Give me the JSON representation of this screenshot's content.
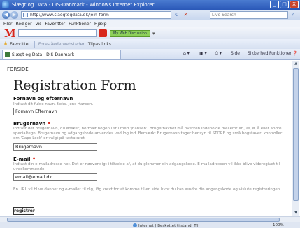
{
  "window": {
    "title": "Slægt og Data - DIS-Danmark - Windows Internet Explorer",
    "minimize": "_",
    "maximize": "□",
    "close": "X"
  },
  "address_bar": {
    "back": "◀",
    "forward": "▶",
    "url": "http://www.slaegtogdata.dk/join_form",
    "refresh": "↻",
    "stop": "✕",
    "search_placeholder": "Live Search",
    "search_go": "⌕"
  },
  "menu": [
    "Filer",
    "Rediger",
    "Vis",
    "Favoritter",
    "Funktioner",
    "Hjælp"
  ],
  "toolbar2": {
    "brand": "M",
    "green_button": "My Web Discussion",
    "chevron": "▾"
  },
  "favorites_bar": {
    "label": "Favoritter",
    "suggested_sites": "Foreslåede websteder",
    "tips": "Tilpas links"
  },
  "tab": {
    "label": "Slægt og Data - DIS-Danmark"
  },
  "command_bar": {
    "side": "Side",
    "security": "Sikkerhed",
    "tools": "Funktioner",
    "help": "❓"
  },
  "page": {
    "breadcrumb": "FORSIDE",
    "heading": "Registration Form",
    "fields": [
      {
        "label": "Fornavn og efternavn",
        "required": false,
        "help": "Indtast dit fulde navn, f.eks. Jens Hansen.",
        "value": "Fornavn Efternavn"
      },
      {
        "label": "Brugernavn",
        "required": true,
        "help": "Indtast det brugernavn, du ønsker, normalt nogen i stil med 'jhansen'. Brugernavnet må hverken indeholde mellemrum, æ, ø, å eller andre specialtegn. Brugernavn og adgangskode anvendes ved log ind. Bemærk: Brugernavn tager hensyn til STORE og små bogstaver, kontroller om 'Caps Lock' er valgt på tastaturet.",
        "value": "Brugernavn"
      },
      {
        "label": "E-mail",
        "required": true,
        "help": "Indtast din e-mailadresse her. Det er nødvendigt i tilfælde af, at du glemmer din adgangskode. E-mailadressen vil ikke blive videregivet til uvedkommende.",
        "value": "email@email.dk"
      }
    ],
    "footer_note": "En URL vil blive dannet og e-mailet til dig, ifig krevt for at komme til en side hvor du kan ændre din adgangskode og vislute registreringen.",
    "submit_label": "registrer",
    "required_mark": "•"
  },
  "status_bar": {
    "zone": "Internet | Beskyttet tilstand: Til",
    "zoom": "100%"
  }
}
